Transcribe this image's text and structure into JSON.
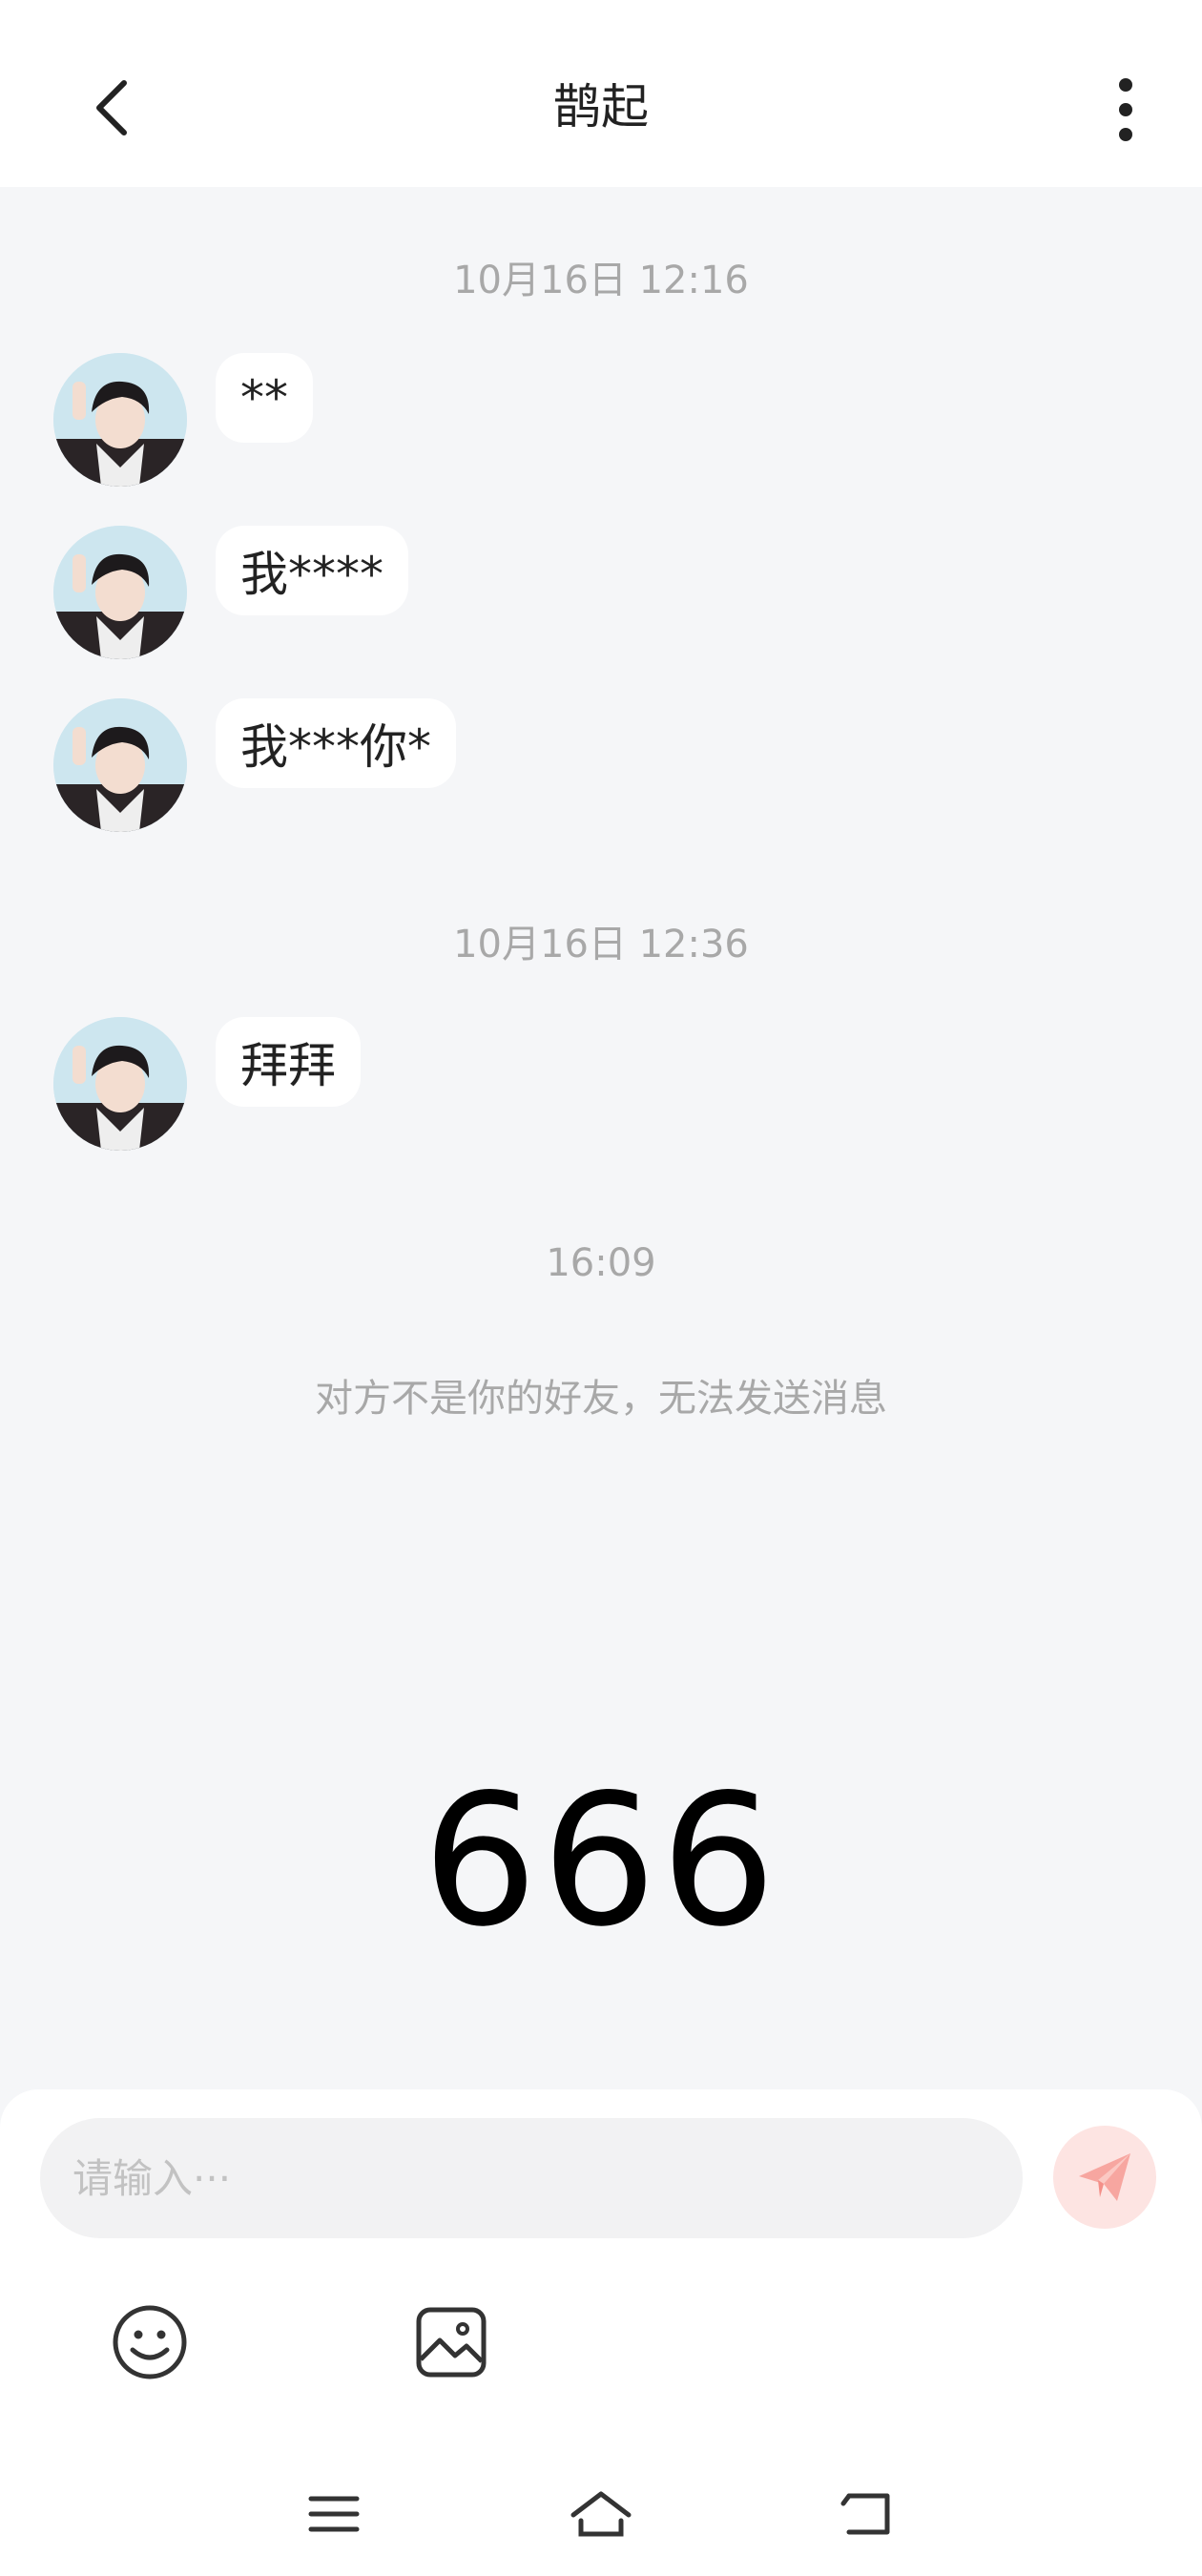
{
  "header": {
    "back_icon": "chevron-left-icon",
    "title": "鹊起",
    "more_icon": "more-vertical-icon"
  },
  "chat": {
    "groups": [
      {
        "timestamp": "10月16日 12:16",
        "messages": [
          {
            "text": "**"
          },
          {
            "text": "我****"
          },
          {
            "text": "我***你*"
          }
        ]
      },
      {
        "timestamp": "10月16日 12:36",
        "messages": [
          {
            "text": "拜拜"
          }
        ]
      },
      {
        "timestamp": "16:09",
        "messages": []
      }
    ],
    "system_note": "对方不是你的好友，无法发送消息",
    "big_number": "666"
  },
  "composer": {
    "placeholder": "请输入···",
    "value": "",
    "send_icon": "paper-plane-icon",
    "emoji_icon": "smiley-icon",
    "image_icon": "image-icon"
  },
  "navbar": {
    "menu_icon": "menu-icon",
    "home_icon": "home-icon",
    "back_icon": "back-icon"
  },
  "colors": {
    "background": "#f5f6f8",
    "bubble": "#ffffff",
    "send_button": "#fde4e2",
    "send_icon": "#f7a6a0",
    "muted_text": "#a8a8a8"
  }
}
